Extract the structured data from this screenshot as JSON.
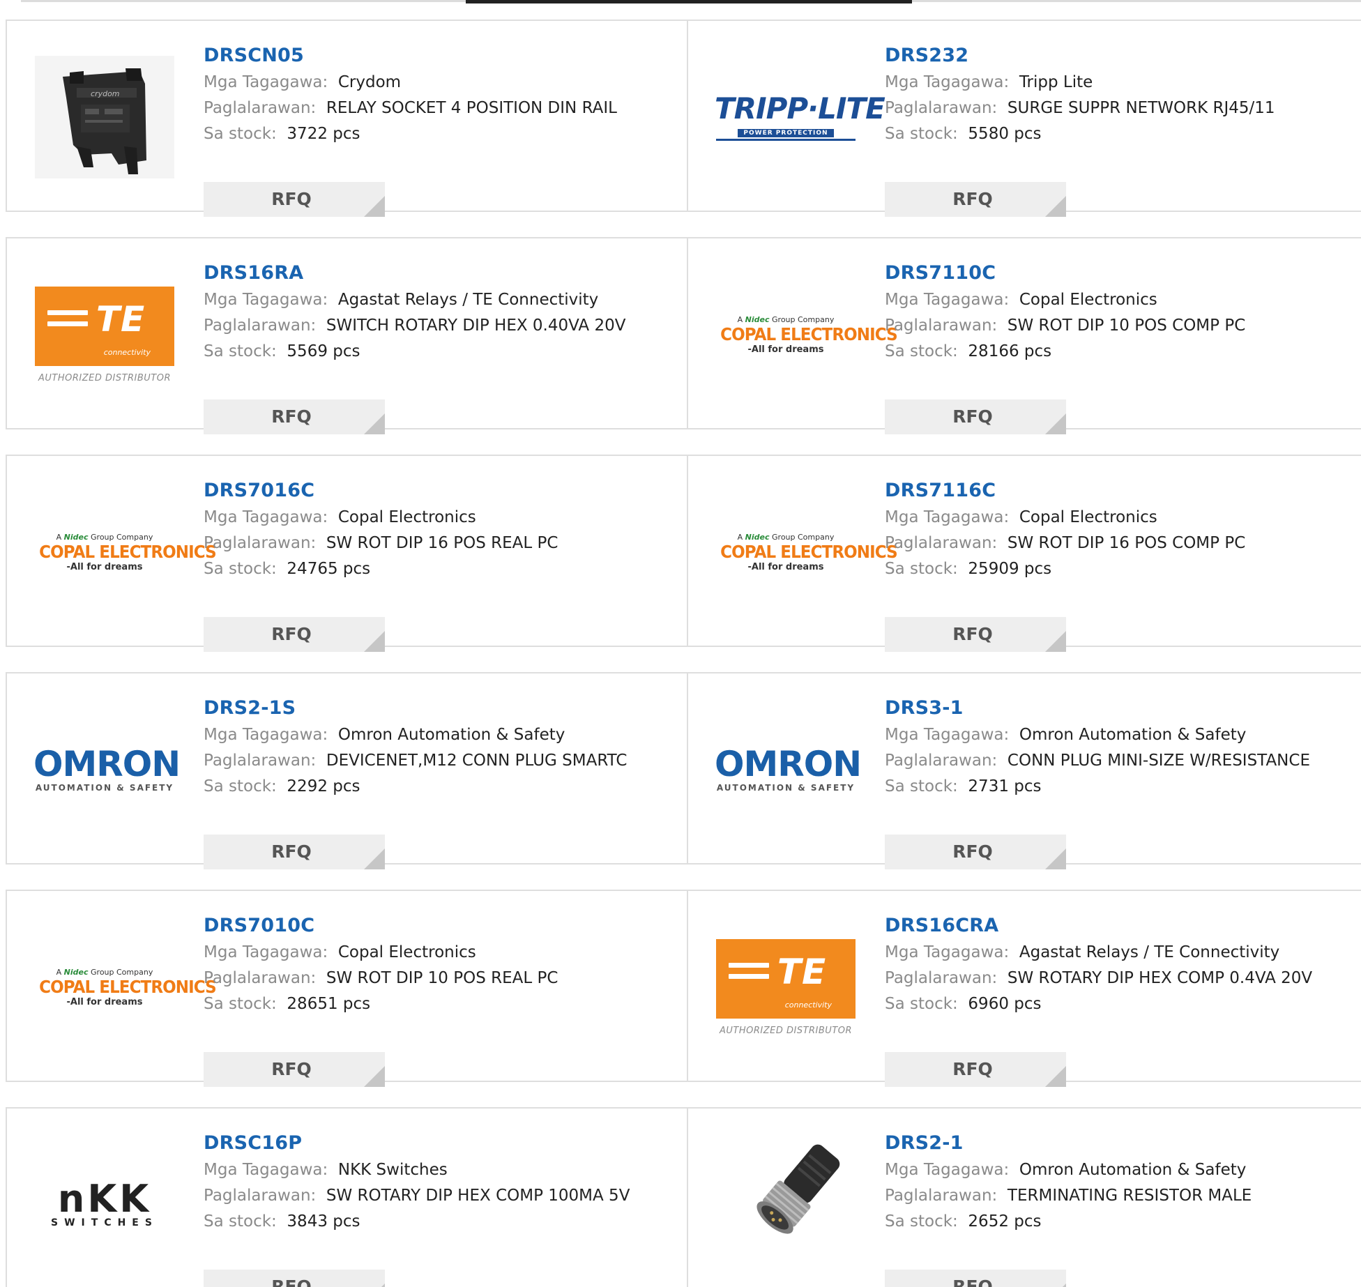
{
  "labels": {
    "manufacturer": "Mga Tagagawa:",
    "description": "Paglalarawan:",
    "stock": "Sa stock:",
    "rfq": "RFQ"
  },
  "logo_text": {
    "te": "TE",
    "te_sub": "connectivity",
    "te_auth": "AUTHORIZED DISTRIBUTOR",
    "copal_top_a": "A",
    "copal_top_nidec": "Nidec",
    "copal_top_b": "Group Company",
    "copal_main": "COPAL ELECTRONICS",
    "copal_tag": "-All for dreams",
    "omron_main": "OMRON",
    "omron_sub": "AUTOMATION & SAFETY",
    "tripp_main": "TRIPP·LITE",
    "tripp_sub": "POWER PROTECTION",
    "nkk_main": "nKK",
    "nkk_sub": "SWITCHES",
    "crydom": "crydom"
  },
  "products": [
    {
      "part": "DRSCN05",
      "manufacturer": "Crydom",
      "description": "RELAY SOCKET 4 POSITION DIN RAIL",
      "stock": "3722 pcs",
      "logo": "crydom-photo"
    },
    {
      "part": "DRS232",
      "manufacturer": "Tripp Lite",
      "description": "SURGE SUPPR NETWORK RJ45/11",
      "stock": "5580 pcs",
      "logo": "tripp-lite"
    },
    {
      "part": "DRS16RA",
      "manufacturer": "Agastat Relays / TE Connectivity",
      "description": "SWITCH ROTARY DIP HEX 0.40VA 20V",
      "stock": "5569 pcs",
      "logo": "te"
    },
    {
      "part": "DRS7110C",
      "manufacturer": "Copal Electronics",
      "description": "SW ROT DIP 10 POS COMP PC",
      "stock": "28166 pcs",
      "logo": "copal"
    },
    {
      "part": "DRS7016C",
      "manufacturer": "Copal Electronics",
      "description": "SW ROT DIP 16 POS REAL PC",
      "stock": "24765 pcs",
      "logo": "copal"
    },
    {
      "part": "DRS7116C",
      "manufacturer": "Copal Electronics",
      "description": "SW ROT DIP 16 POS COMP PC",
      "stock": "25909 pcs",
      "logo": "copal"
    },
    {
      "part": "DRS2-1S",
      "manufacturer": "Omron Automation & Safety",
      "description": "DEVICENET,M12 CONN PLUG SMARTC",
      "stock": "2292 pcs",
      "logo": "omron"
    },
    {
      "part": "DRS3-1",
      "manufacturer": "Omron Automation & Safety",
      "description": "CONN PLUG MINI-SIZE W/RESISTANCE",
      "stock": "2731 pcs",
      "logo": "omron"
    },
    {
      "part": "DRS7010C",
      "manufacturer": "Copal Electronics",
      "description": "SW ROT DIP 10 POS REAL PC",
      "stock": "28651 pcs",
      "logo": "copal"
    },
    {
      "part": "DRS16CRA",
      "manufacturer": "Agastat Relays / TE Connectivity",
      "description": "SW ROTARY DIP HEX COMP 0.4VA 20V",
      "stock": "6960 pcs",
      "logo": "te"
    },
    {
      "part": "DRSC16P",
      "manufacturer": "NKK Switches",
      "description": "SW ROTARY DIP HEX COMP 100MA 5V",
      "stock": "3843 pcs",
      "logo": "nkk"
    },
    {
      "part": "DRS2-1",
      "manufacturer": "Omron Automation & Safety",
      "description": "TERMINATING RESISTOR MALE",
      "stock": "2652 pcs",
      "logo": "connector-photo"
    }
  ]
}
